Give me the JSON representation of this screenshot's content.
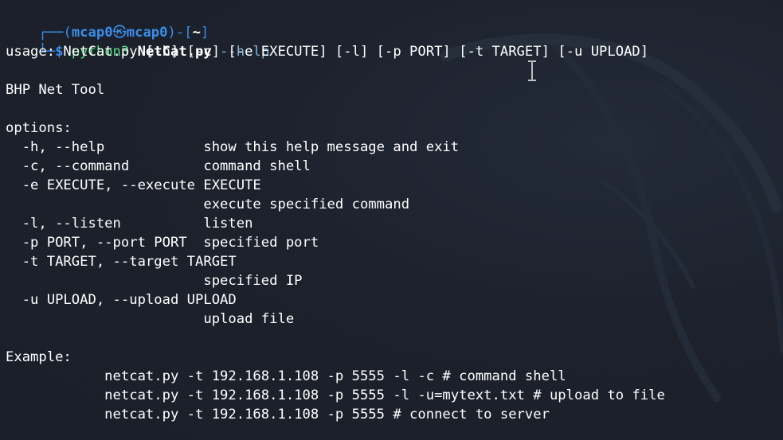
{
  "prompt": {
    "bracket_open": "┌──(",
    "user": "mcap0",
    "skull": "㉿",
    "host": "mcap0",
    "bracket_mid": ")-[",
    "dir": "~",
    "bracket_close": "]",
    "corner": "└─",
    "dollar": "$ ",
    "cmd_prefix": "python3 ",
    "cmd_file": "NetCat.py",
    "cmd_arg": " --help"
  },
  "output": {
    "usage": "usage: NetCat.py [-h] [-c] [-e EXECUTE] [-l] [-p PORT] [-t TARGET] [-u UPLOAD]",
    "description": "BHP Net Tool",
    "options_header": "options:",
    "options": [
      "  -h, --help            show this help message and exit",
      "  -c, --command         command shell",
      "  -e EXECUTE, --execute EXECUTE",
      "                        execute specified command",
      "  -l, --listen          listen",
      "  -p PORT, --port PORT  specified port",
      "  -t TARGET, --target TARGET",
      "                        specified IP",
      "  -u UPLOAD, --upload UPLOAD",
      "                        upload file"
    ],
    "example_header": "Example:",
    "examples": [
      "            netcat.py -t 192.168.1.108 -p 5555 -l -c # command shell",
      "            netcat.py -t 192.168.1.108 -p 5555 -l -u=mytext.txt # upload to file",
      "            netcat.py -t 192.168.1.108 -p 5555 # connect to server"
    ]
  },
  "colors": {
    "background": "#1b202b",
    "prompt": "#3b8eea",
    "command": "#4ee07c",
    "text": "#ffffff"
  },
  "icons": {
    "text_cursor": "i-beam-cursor-icon"
  }
}
